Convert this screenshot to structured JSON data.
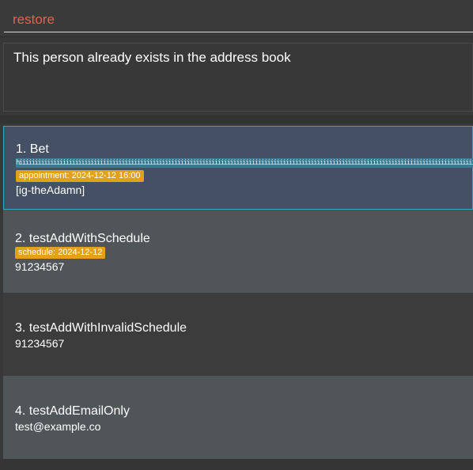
{
  "command": {
    "value": "restore"
  },
  "result": {
    "message": "This person already exists in the address book"
  },
  "persons": [
    {
      "name": "1. Bet",
      "tag_text": "hiiiiiiiiiiiiiiiiiiiiiiiiiiiiiiiiiiiiiiiiiiiiiiiiiiiiiiiiiiiiiiiiiiiiiiiiiiiiiiiiiiiiiiiiiiiiiiiiiiiiiiiiiiiiiiiiiiiiiiiiiiiiiiiiiiiiiiiiiiiiiiiiiiiiiiiiiiiiiiiiiiiiiiiiiiiiiiiiiiiiiiiiiiiiiiiiiiiiiiiiiiiiiiiiiiiiiiiiiiiiiiiiiiiiiiiiiiiiiiiiiiiiiiiiiiiiiiiiiiiiiiiiiiiiiiiiiiiiiiiiiiiiiiiiiiiiiiiiiiiiiiiiiiiiiiiiiiiiiiiiiiiiiiiiiiiiiiiiiiiiiiiiiiiiiiiiiiiiiiiiiiiiiiiiiiiii",
      "badge": "appointment: 2024-12-12 16:00",
      "detail": "[ig-theAdamn]"
    },
    {
      "name": "2. testAddWithSchedule",
      "badge": "schedule: 2024-12-12",
      "detail": "91234567"
    },
    {
      "name": "3. testAddWithInvalidSchedule",
      "detail": "91234567"
    },
    {
      "name": "4. testAddEmailOnly",
      "detail": "test@example.co"
    }
  ],
  "colors": {
    "error_text": "#e06450",
    "selected_card": "#445064",
    "selected_border": "#3aa6c0",
    "badge": "#e2a117",
    "tag_stripe": "#3a7a92"
  }
}
